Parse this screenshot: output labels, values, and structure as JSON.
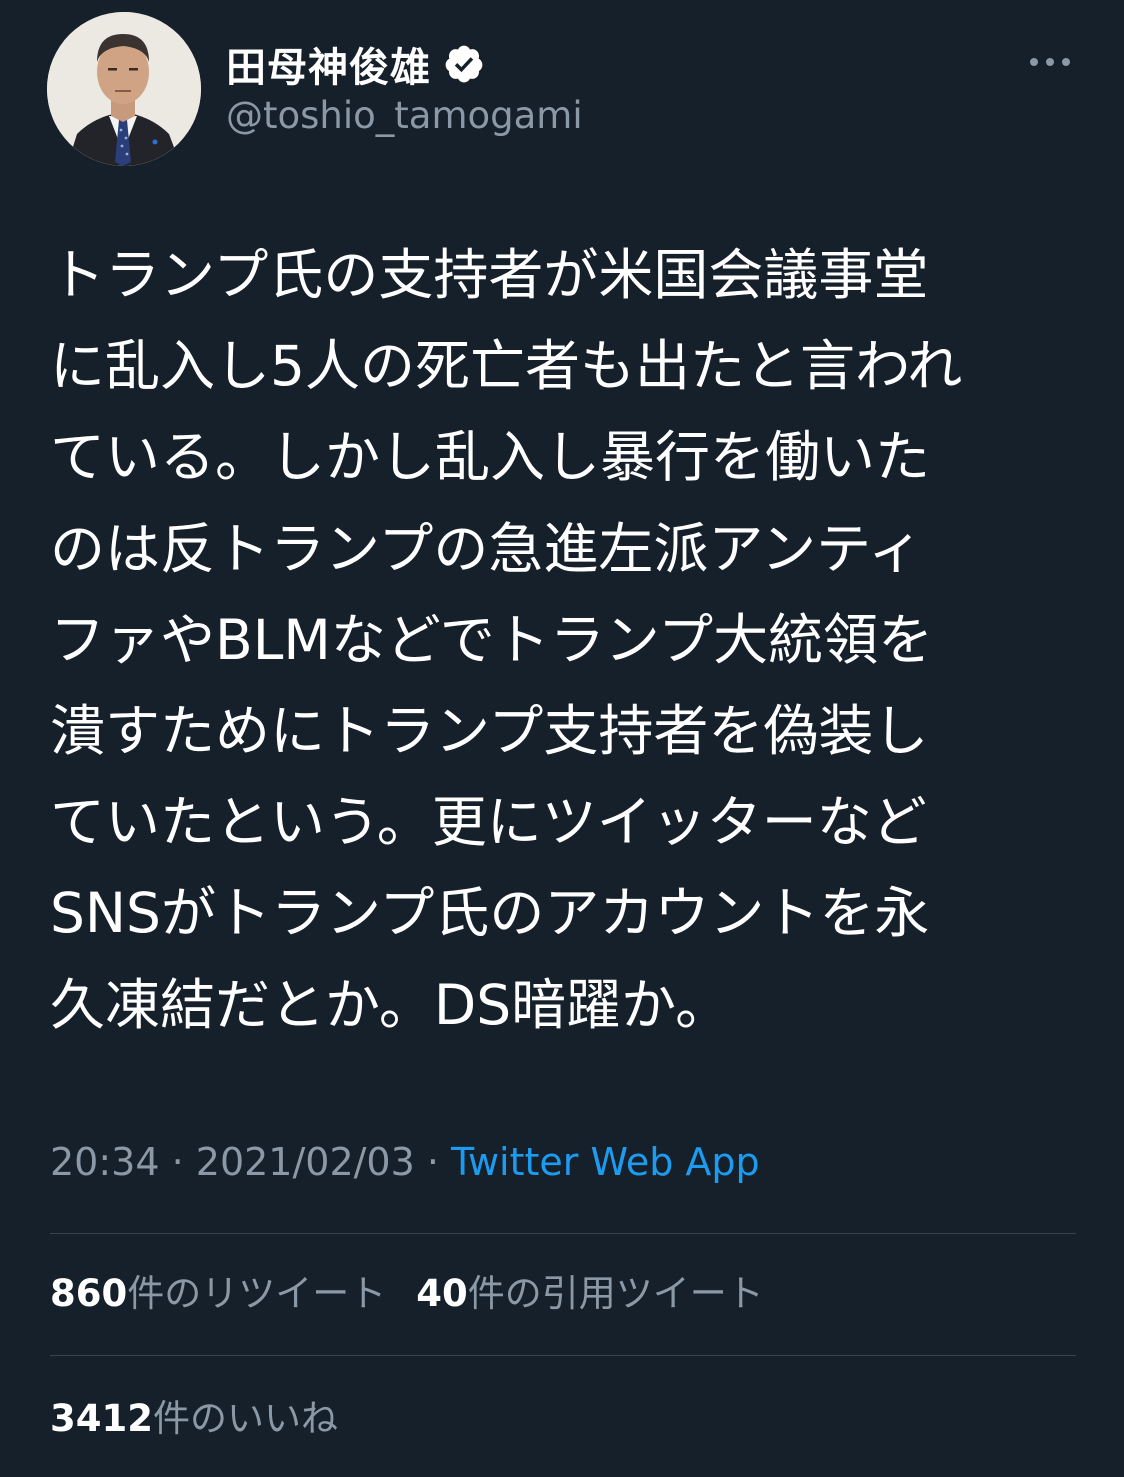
{
  "user": {
    "display_name": "田母神俊雄",
    "handle": "@toshio_tamogami",
    "verified_icon": "verified-badge-icon"
  },
  "tweet": {
    "text_lines": [
      "トランプ氏の支持者が米国会議事堂",
      "に乱入し5人の死亡者も出たと言われ",
      "ている。しかし乱入し暴行を働いた",
      "のは反トランプの急進左派アンティ",
      "ファやBLMなどでトランプ大統領を",
      "潰すためにトランプ支持者を偽装し",
      "ていたという。更にツイッターなど",
      "SNSがトランプ氏のアカウントを永",
      "久凍結だとか。DS暗躍か。"
    ],
    "time": "20:34",
    "separator": " · ",
    "date": "2021/02/03",
    "source": "Twitter Web App"
  },
  "stats": {
    "retweets_count": "860",
    "retweets_label": "件のリツイート",
    "quotes_count": "40",
    "quotes_label": "件の引用ツイート",
    "likes_count": "3412",
    "likes_label": "件のいいね"
  },
  "colors": {
    "background": "#15202b",
    "text": "#ffffff",
    "secondary": "#8b98a5",
    "link": "#1d9bf0",
    "divider": "#38444d"
  }
}
